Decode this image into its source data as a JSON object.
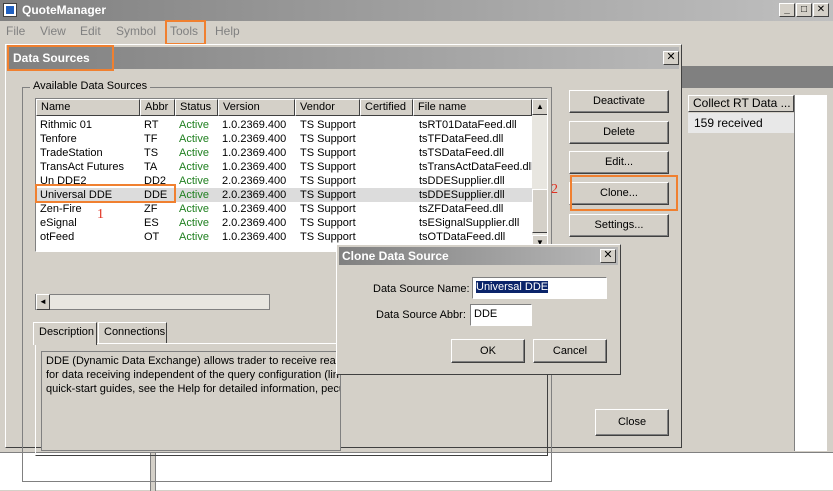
{
  "app": {
    "title": "QuoteManager",
    "menu": [
      "File",
      "View",
      "Edit",
      "Symbol",
      "Tools",
      "Help"
    ],
    "menu_underline": [
      "F",
      "V",
      "E",
      "S",
      "T",
      "H"
    ]
  },
  "background_grid": {
    "header": "Collect RT Data ...",
    "cell": "159 received"
  },
  "data_sources_dialog": {
    "title": "Data Sources",
    "group_label": "Available Data Sources",
    "columns": [
      "Name",
      "Abbr",
      "Status",
      "Version",
      "Vendor",
      "Certified",
      "File name"
    ],
    "rows": [
      {
        "name": "Rithmic 01",
        "abbr": "RT",
        "status": "Active",
        "version": "1.0.2369.400",
        "vendor": "TS Support",
        "certified": "",
        "file": "tsRT01DataFeed.dll"
      },
      {
        "name": "Tenfore",
        "abbr": "TF",
        "status": "Active",
        "version": "1.0.2369.400",
        "vendor": "TS Support",
        "certified": "",
        "file": "tsTFDataFeed.dll"
      },
      {
        "name": "TradeStation",
        "abbr": "TS",
        "status": "Active",
        "version": "1.0.2369.400",
        "vendor": "TS Support",
        "certified": "",
        "file": "tsTSDataFeed.dll"
      },
      {
        "name": "TransAct Futures",
        "abbr": "TA",
        "status": "Active",
        "version": "1.0.2369.400",
        "vendor": "TS Support",
        "certified": "",
        "file": "tsTransActDataFeed.dll"
      },
      {
        "name": "Un DDE2",
        "abbr": "DD2",
        "status": "Active",
        "version": "2.0.2369.400",
        "vendor": "TS Support",
        "certified": "",
        "file": "tsDDESupplier.dll"
      },
      {
        "name": "Universal DDE",
        "abbr": "DDE",
        "status": "Active",
        "version": "2.0.2369.400",
        "vendor": "TS Support",
        "certified": "",
        "file": "tsDDESupplier.dll"
      },
      {
        "name": "Zen-Fire",
        "abbr": "ZF",
        "status": "Active",
        "version": "1.0.2369.400",
        "vendor": "TS Support",
        "certified": "",
        "file": "tsZFDataFeed.dll"
      },
      {
        "name": "eSignal",
        "abbr": "ES",
        "status": "Active",
        "version": "2.0.2369.400",
        "vendor": "TS Support",
        "certified": "",
        "file": "tsESignalSupplier.dll"
      },
      {
        "name": "otFeed",
        "abbr": "OT",
        "status": "Active",
        "version": "1.0.2369.400",
        "vendor": "TS Support",
        "certified": "",
        "file": "tsOTDataFeed.dll"
      }
    ],
    "selected_row": "Universal DDE",
    "tabs": [
      "Description",
      "Connections"
    ],
    "description_lines": [
      "DDE (Dynamic Data Exchange) allows trader to receive real-ti",
      "for data receiving independent of the query configuration (lin",
      "quick-start guides, see the Help for detailed information, pecu"
    ],
    "buttons": {
      "deactivate": "Deactivate",
      "delete": "Delete",
      "edit": "Edit...",
      "clone": "Clone...",
      "settings": "Settings...",
      "close": "Close"
    }
  },
  "annotations": {
    "marker_1": "1",
    "marker_2": "2"
  },
  "clone_dialog": {
    "title": "Clone Data Source",
    "name_label": "Data Source Name:",
    "name_value": "Universal DDE",
    "abbr_label": "Data Source Abbr:",
    "abbr_value": "DDE",
    "ok": "OK",
    "cancel": "Cancel"
  },
  "colors": {
    "status_active": "#208020",
    "highlight": "#f08030",
    "annotation": "#e03020"
  }
}
